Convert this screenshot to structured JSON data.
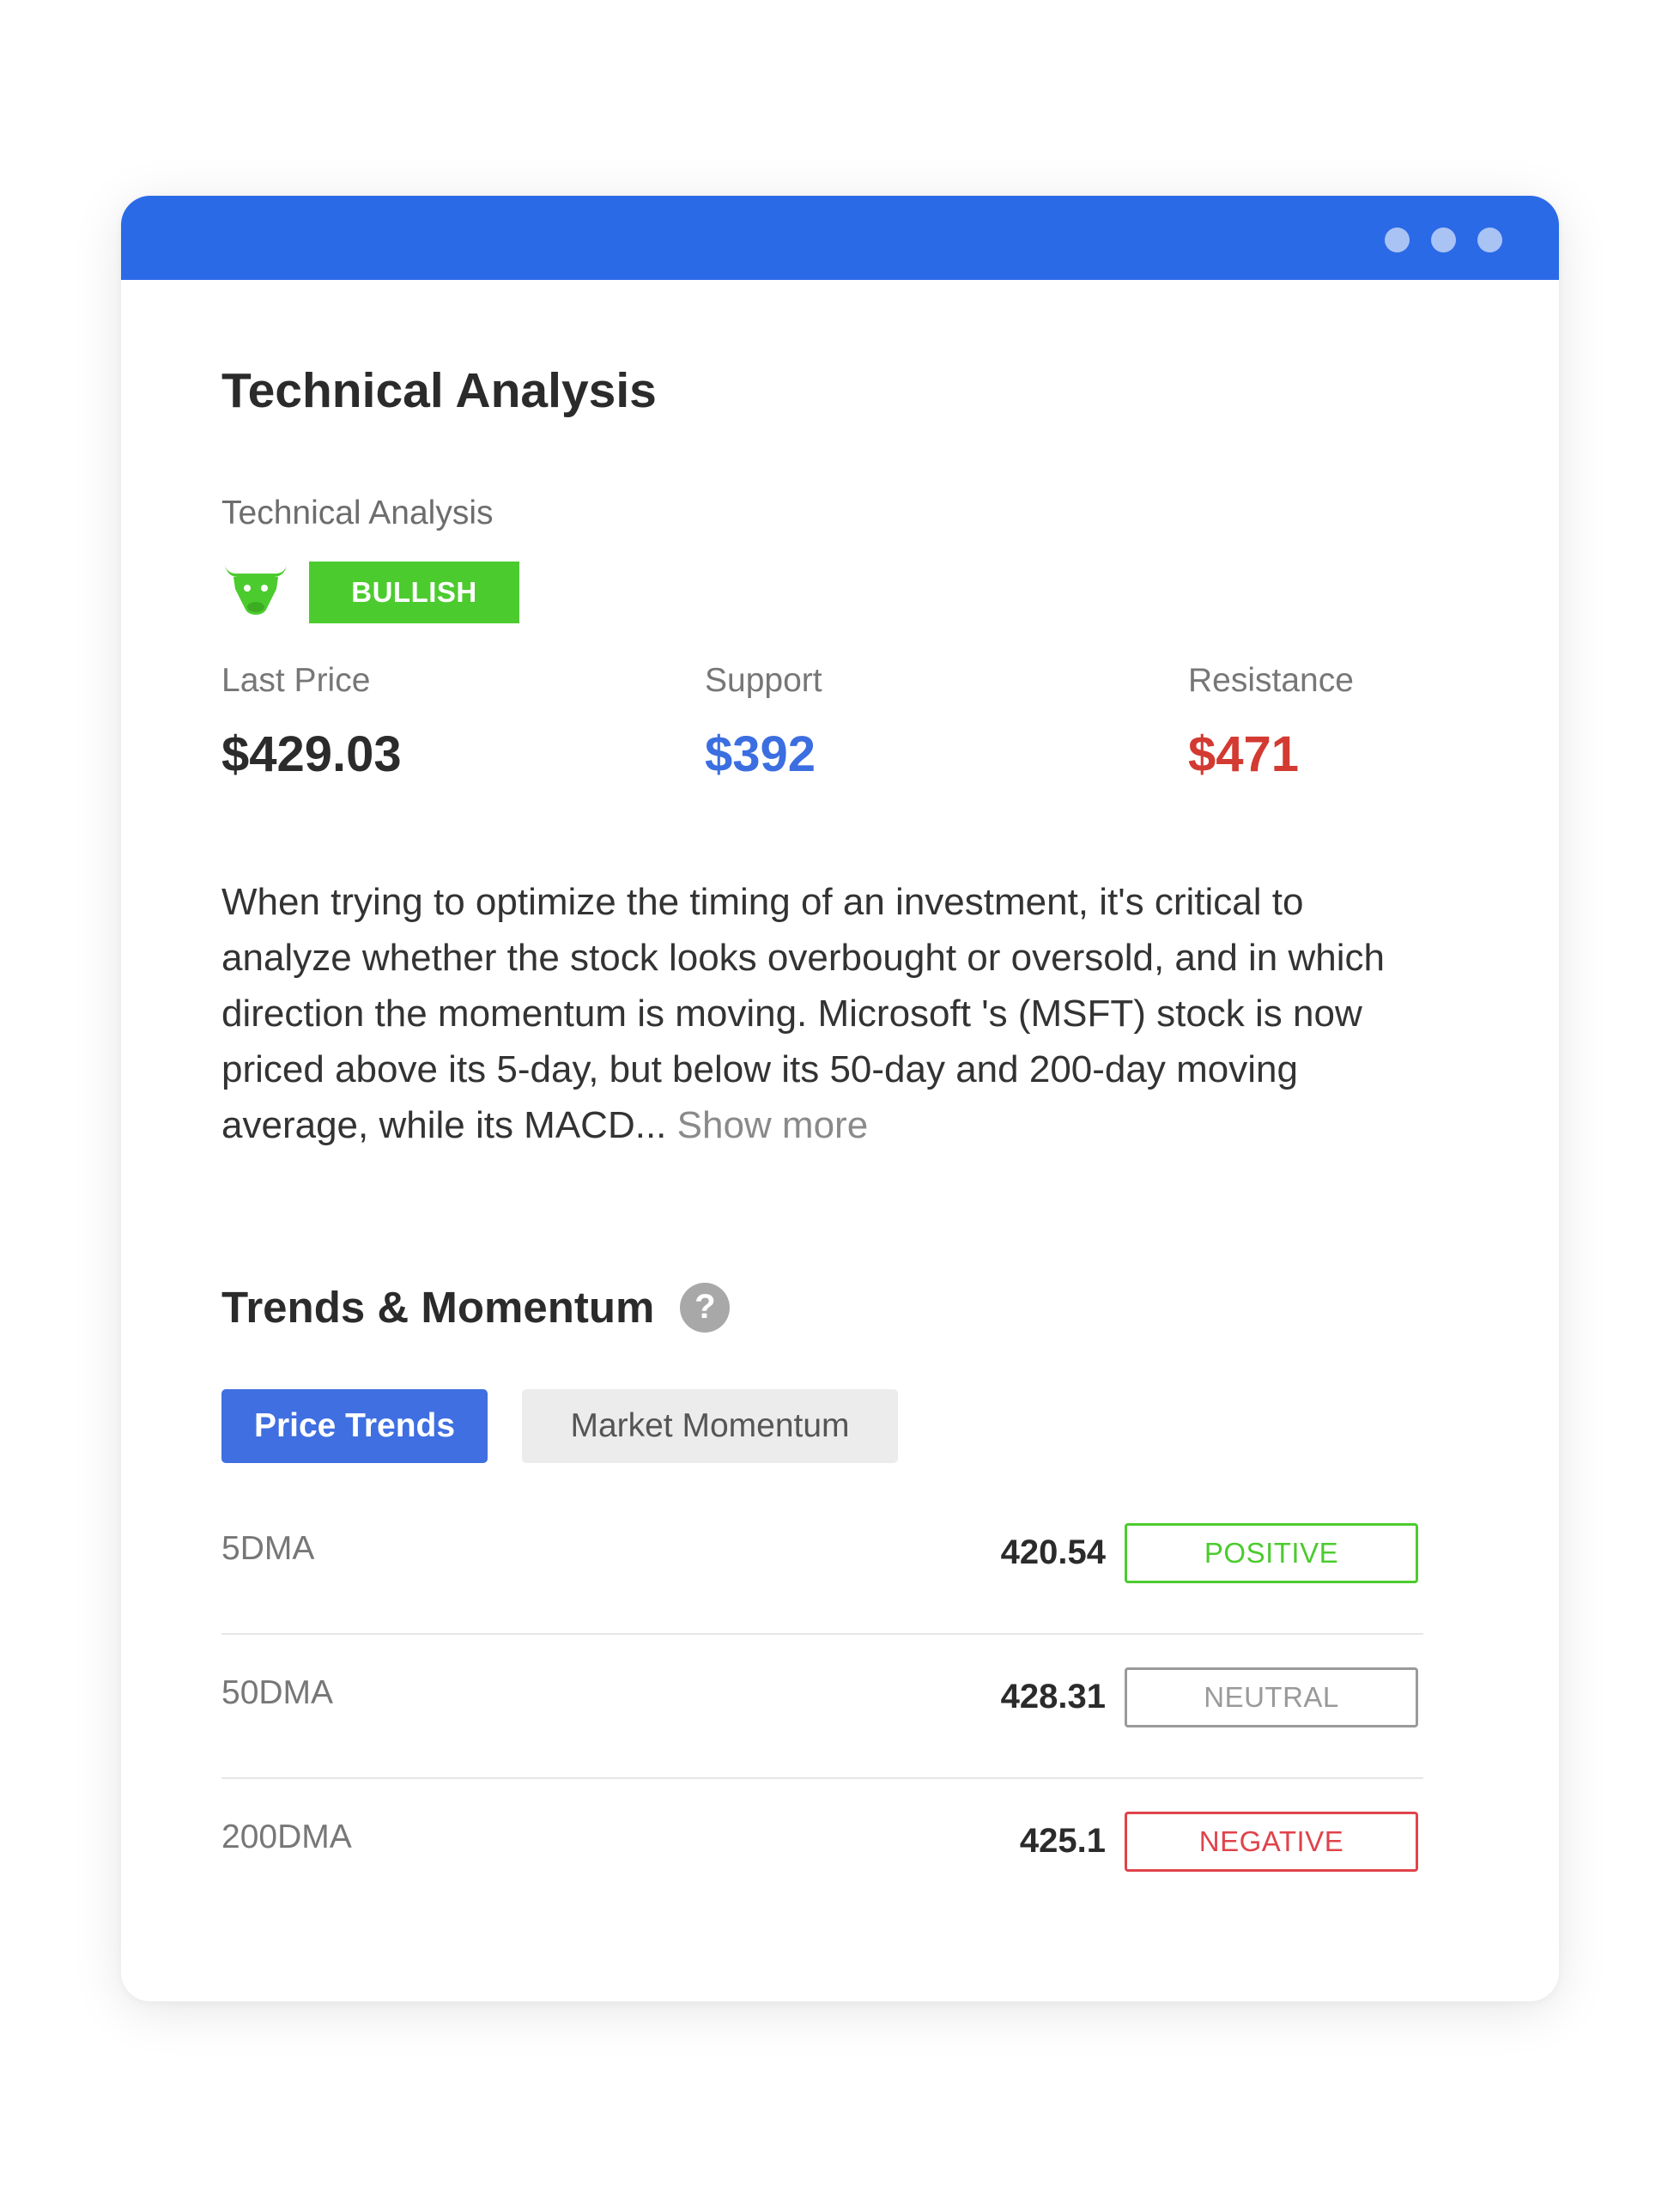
{
  "header": {
    "title": "Technical Analysis",
    "dots": [
      "dot",
      "dot",
      "dot"
    ]
  },
  "analysis": {
    "label": "Technical Analysis",
    "sentiment_icon": "bull-icon",
    "sentiment": "BULLISH",
    "sentiment_color": "#4ccb2f"
  },
  "stats": {
    "last_price_label": "Last Price",
    "last_price": "$429.03",
    "support_label": "Support",
    "support": "$392",
    "support_color": "#3b6ee0",
    "resistance_label": "Resistance",
    "resistance": "$471",
    "resistance_color": "#d33a32"
  },
  "description": {
    "text": "When trying to optimize the timing of an investment, it's critical to analyze whether the stock looks overbought or oversold, and in which direction the momentum is moving. Microsoft 's (MSFT) stock is now priced above its 5-day, but below its 50-day and 200-day moving average, while its MACD...",
    "show_more": "Show more"
  },
  "trends": {
    "title": "Trends & Momentum",
    "help_icon": "question-icon",
    "help_glyph": "?",
    "tabs": [
      {
        "label": "Price Trends",
        "active": true
      },
      {
        "label": "Market Momentum",
        "active": false
      }
    ],
    "rows": [
      {
        "label": "5DMA",
        "value": "420.54",
        "status": "POSITIVE",
        "status_color": "#4ccb2f"
      },
      {
        "label": "50DMA",
        "value": "428.31",
        "status": "NEUTRAL",
        "status_color": "#9a9a9a"
      },
      {
        "label": "200DMA",
        "value": "425.1",
        "status": "NEGATIVE",
        "status_color": "#e0434b"
      }
    ]
  }
}
